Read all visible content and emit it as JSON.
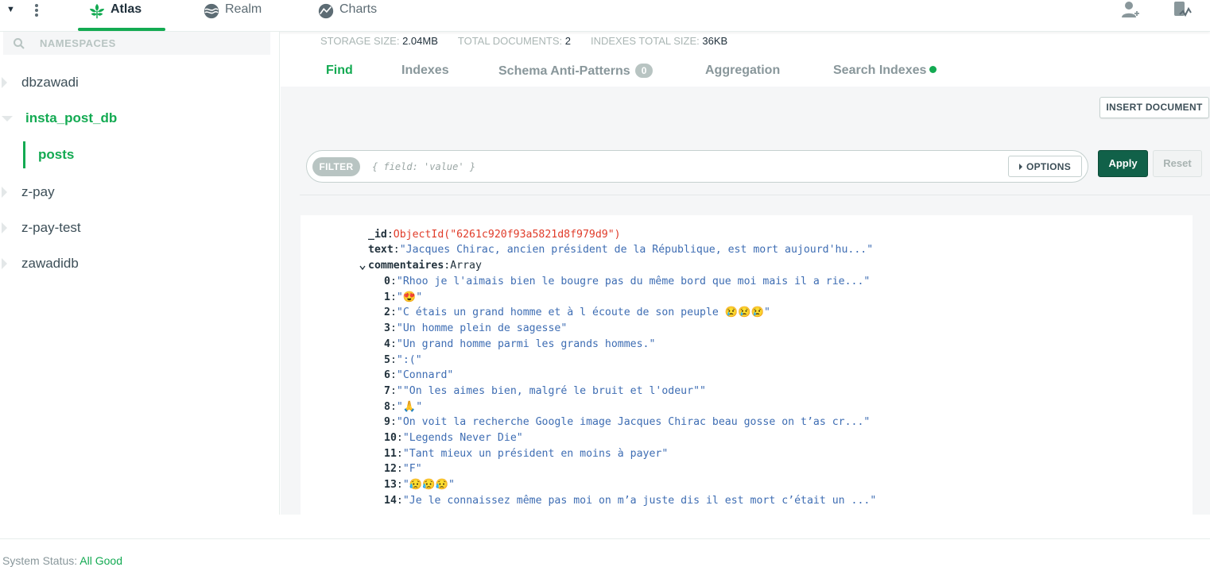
{
  "topnav": {
    "tabs": [
      {
        "label": "Atlas",
        "icon": "atlas-leaf-icon",
        "active": true
      },
      {
        "label": "Realm",
        "icon": "realm-icon",
        "active": false
      },
      {
        "label": "Charts",
        "icon": "charts-icon",
        "active": false
      }
    ],
    "right_icons": [
      "add-user-icon",
      "activity-icon"
    ]
  },
  "sidebar": {
    "search_placeholder": "NAMESPACES",
    "databases": [
      {
        "label": "dbzawadi",
        "expanded": false
      },
      {
        "label": "insta_post_db",
        "expanded": true
      },
      {
        "label": "z-pay",
        "expanded": false
      },
      {
        "label": "z-pay-test",
        "expanded": false
      },
      {
        "label": "zawadidb",
        "expanded": false
      }
    ],
    "active_collection": "posts"
  },
  "stats": {
    "storage_label": "STORAGE SIZE:",
    "storage_value": "2.04MB",
    "docs_label": "TOTAL DOCUMENTS:",
    "docs_value": "2",
    "indexes_label": "INDEXES TOTAL SIZE:",
    "indexes_value": "36KB"
  },
  "tabs": {
    "find": "Find",
    "indexes": "Indexes",
    "schema": "Schema Anti-Patterns",
    "schema_badge": "0",
    "aggregation": "Aggregation",
    "search": "Search Indexes",
    "active": "Find"
  },
  "toolbar": {
    "insert_label": "INSERT DOCUMENT",
    "filter_label": "FILTER",
    "filter_placeholder": "{ field: 'value' }",
    "options_label": "OPTIONS",
    "apply_label": "Apply",
    "reset_label": "Reset"
  },
  "document": {
    "id_key": "_id",
    "id_value": "ObjectId(\"6261c920f93a5821d8f979d9\")",
    "text_key": "text",
    "text_value": "\"Jacques Chirac, ancien président de la République, est mort aujourd'hu...\"",
    "array_key": "commentaires",
    "array_type": "Array",
    "items": [
      {
        "i": "0",
        "v": "\"Rhoo je l'aimais bien le bougre pas du même bord que moi mais il a rie...\""
      },
      {
        "i": "1",
        "v": "\"😍\""
      },
      {
        "i": "2",
        "v": "\"C étais un grand homme et à l écoute de son peuple 😢😢😢\""
      },
      {
        "i": "3",
        "v": "\"Un homme plein de sagesse\""
      },
      {
        "i": "4",
        "v": "\"Un grand homme parmi les grands hommes.\""
      },
      {
        "i": "5",
        "v": "\":(\""
      },
      {
        "i": "6",
        "v": "\"Connard\""
      },
      {
        "i": "7",
        "v": "\"\"On les aimes bien, malgré le bruit et l'odeur\"\""
      },
      {
        "i": "8",
        "v": "\"🙏\""
      },
      {
        "i": "9",
        "v": "\"On voit la recherche Google image Jacques Chirac beau gosse on t’as cr...\""
      },
      {
        "i": "10",
        "v": "\"Legends Never Die\""
      },
      {
        "i": "11",
        "v": "\"Tant mieux un président en moins à payer\""
      },
      {
        "i": "12",
        "v": "\"F\""
      },
      {
        "i": "13",
        "v": "\"😥😥😥\""
      },
      {
        "i": "14",
        "v": "\"Je le connaissez même pas moi on m’a juste dis il est mort c’était un ...\""
      }
    ]
  },
  "footer": {
    "status_label": "System Status:",
    "status_value": "All Good"
  },
  "colors": {
    "brand_green": "#13aa52",
    "apply_green": "#116149",
    "objectid_red": "#e03c2a",
    "string_blue": "#3e6db3"
  }
}
